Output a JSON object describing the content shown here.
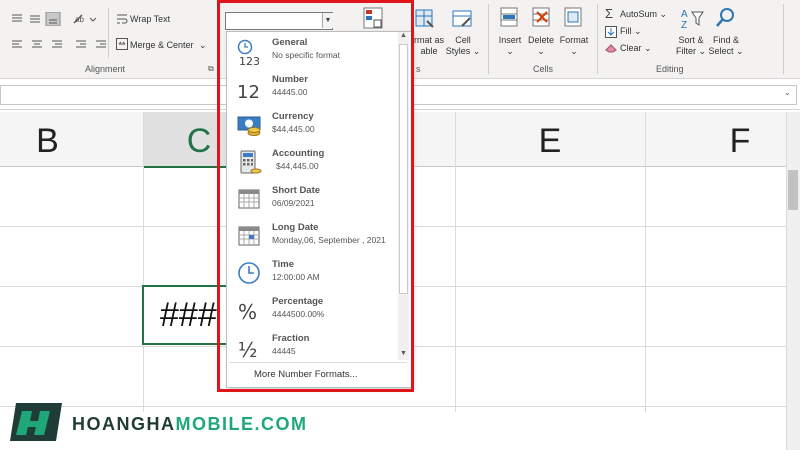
{
  "ribbon": {
    "wrap_text": "Wrap Text",
    "merge_center": "Merge & Center",
    "alignment_group": "Alignment",
    "format_as_table": "Format as Table",
    "format_as_table_line1": "rmat as",
    "format_as_table_line2": "able",
    "cell_styles_line1": "Cell",
    "cell_styles_line2": "Styles",
    "styles_group": "s",
    "insert": "Insert",
    "delete": "Delete",
    "format": "Format",
    "cells_group": "Cells",
    "autosum": "AutoSum",
    "fill": "Fill",
    "clear": "Clear",
    "sort_filter_line1": "Sort &",
    "sort_filter_line2": "Filter",
    "find_select_line1": "Find &",
    "find_select_line2": "Select",
    "editing_group": "Editing"
  },
  "number_format_box": {
    "value": ""
  },
  "number_formats": [
    {
      "name": "General",
      "sample": "No specific format",
      "icon": "general-123-icon"
    },
    {
      "name": "Number",
      "sample": "44445.00",
      "icon": "number-12-icon"
    },
    {
      "name": "Currency",
      "sample": "$44,445.00",
      "icon": "currency-icon"
    },
    {
      "name": "Accounting",
      "sample": "$44,445.00",
      "icon": "accounting-icon"
    },
    {
      "name": "Short Date",
      "sample": "06/09/2021",
      "icon": "calendar-icon"
    },
    {
      "name": "Long Date",
      "sample": "Monday,06, September , 2021",
      "icon": "calendar-icon"
    },
    {
      "name": "Time",
      "sample": "12:00:00 AM",
      "icon": "clock-icon"
    },
    {
      "name": "Percentage",
      "sample": "4444500.00%",
      "icon": "percent-icon"
    },
    {
      "name": "Fraction",
      "sample": "44445",
      "icon": "fraction-icon"
    }
  ],
  "more_formats": "More Number Formats...",
  "columns": [
    "B",
    "C",
    "E",
    "F"
  ],
  "cell_value": "###",
  "watermark": {
    "text_part1": "HOANGHA",
    "text_part2": "MOBILE.COM",
    "color_dark": "#1f3d36",
    "color_accent": "#1fa77a"
  },
  "colors": {
    "highlight_border": "#e0151c",
    "selected_cell_border": "#217346",
    "selected_col_header": "#e1e1e1"
  }
}
